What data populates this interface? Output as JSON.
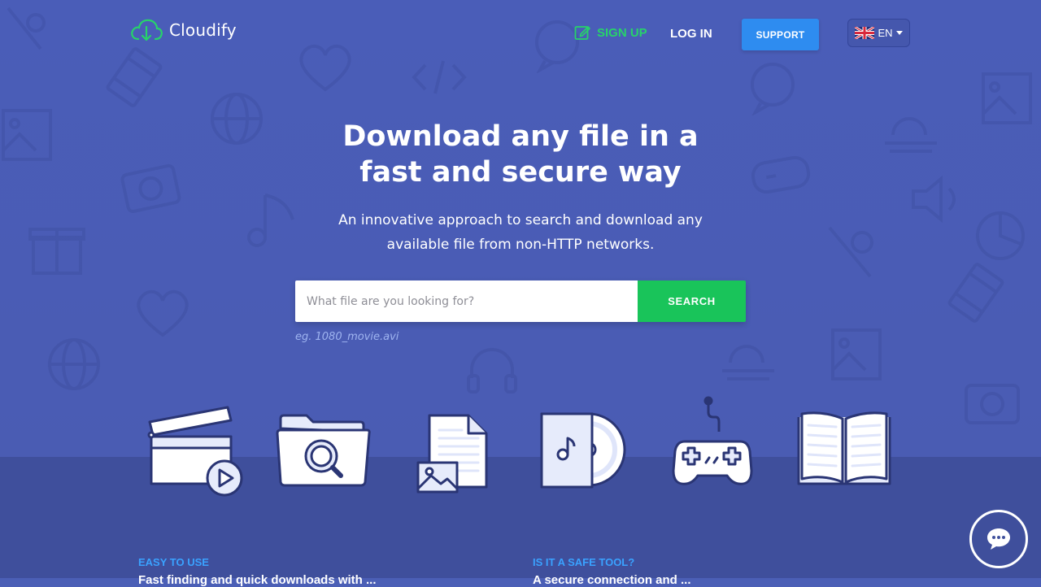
{
  "brand": {
    "name": "Cloudify"
  },
  "nav": {
    "signup": "SIGN UP",
    "login": "LOG IN",
    "support": "SUPPORT",
    "language": "EN"
  },
  "hero": {
    "title_line1": "Download any file in a",
    "title_line2": "fast and secure way",
    "subtitle_line1": "An innovative approach to search and download any",
    "subtitle_line2": "available file from non-HTTP networks."
  },
  "search": {
    "placeholder": "What file are you looking for?",
    "value": "",
    "button": "SEARCH",
    "hint": "eg. 1080_movie.avi"
  },
  "categories": [
    {
      "icon": "movie-clapper-icon"
    },
    {
      "icon": "folder-search-icon"
    },
    {
      "icon": "document-image-icon"
    },
    {
      "icon": "music-disc-icon"
    },
    {
      "icon": "gamepad-icon"
    },
    {
      "icon": "open-book-icon"
    }
  ],
  "sections": [
    {
      "label": "EASY TO USE",
      "text": "Fast finding and quick downloads with ..."
    },
    {
      "label": "IS IT A SAFE TOOL?",
      "text": "A secure connection and ..."
    }
  ],
  "colors": {
    "background": "#4a5db8",
    "band": "#3f4f9c",
    "accent_green": "#19c45a",
    "accent_blue": "#2e8cf0",
    "label_blue": "#3aa2ff"
  }
}
